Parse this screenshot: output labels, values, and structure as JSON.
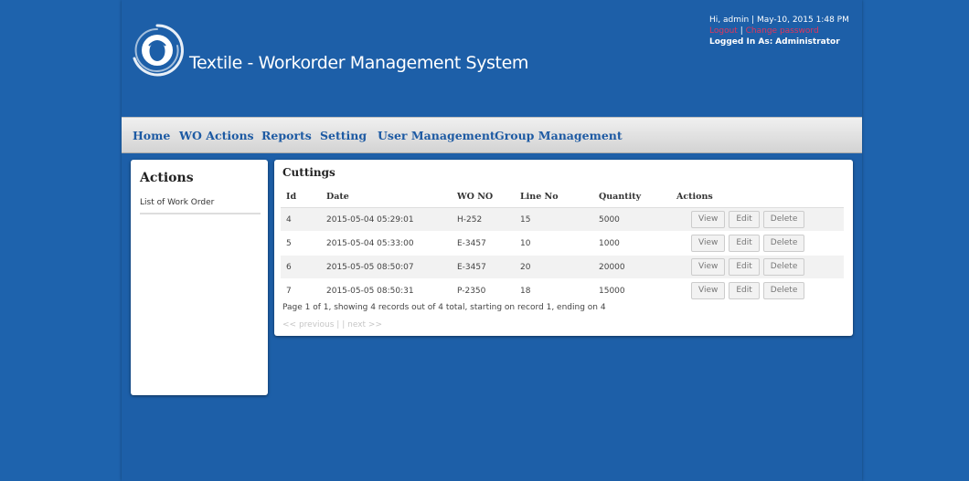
{
  "header": {
    "title": "Textile - Workorder Management System",
    "greeting": "Hi, admin | May-10, 2015 1:48 PM",
    "logout_label": "Logout",
    "separator": "|",
    "change_password_label": "Change password",
    "logged_in_prefix": "Logged In As:",
    "role": "Administrator"
  },
  "nav": {
    "items": [
      "Home",
      "WO Actions",
      "Reports",
      "Setting",
      "User Management",
      "Group Management"
    ]
  },
  "sidebar": {
    "title": "Actions",
    "items": [
      "List of Work Order"
    ]
  },
  "main": {
    "title": "Cuttings",
    "columns": [
      "Id",
      "Date",
      "WO NO",
      "Line No",
      "Quantity",
      "Actions"
    ],
    "rows": [
      {
        "id": "4",
        "date": "2015-05-04 05:29:01",
        "wo_no": "H-252",
        "line_no": "15",
        "quantity": "5000"
      },
      {
        "id": "5",
        "date": "2015-05-04 05:33:00",
        "wo_no": "E-3457",
        "line_no": "10",
        "quantity": "1000"
      },
      {
        "id": "6",
        "date": "2015-05-05 08:50:07",
        "wo_no": "E-3457",
        "line_no": "20",
        "quantity": "20000"
      },
      {
        "id": "7",
        "date": "2015-05-05 08:50:31",
        "wo_no": "P-2350",
        "line_no": "18",
        "quantity": "15000"
      }
    ],
    "row_actions": [
      "View",
      "Edit",
      "Delete"
    ],
    "page_info": "Page 1 of 1, showing 4 records out of 4 total, starting on record 1, ending on 4",
    "pager": {
      "previous": "<< previous",
      "separator": "|",
      "next": "| next >>"
    }
  },
  "colors": {
    "background": "#1e63ad",
    "nav_link": "#1d5aa3",
    "alert_link": "#e0365c"
  },
  "icons": {
    "logo": "swirl-logo-icon"
  }
}
